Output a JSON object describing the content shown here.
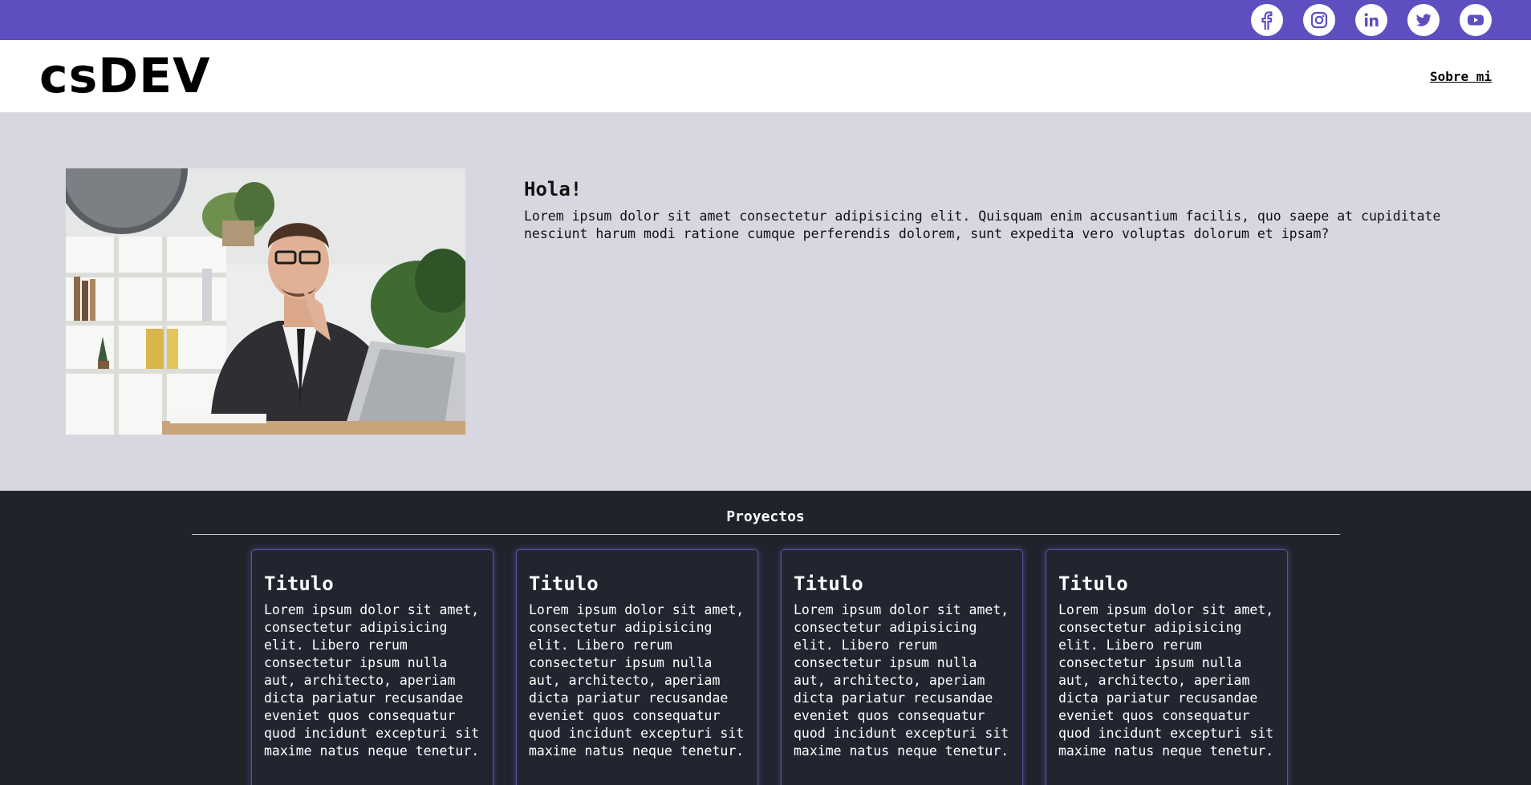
{
  "header": {
    "social_icons": [
      "facebook-icon",
      "instagram-icon",
      "linkedin-icon",
      "twitter-icon",
      "youtube-icon"
    ],
    "accent_color": "#5d4fc0"
  },
  "nav": {
    "logo": "csDEV",
    "link_label": "Sobre mi"
  },
  "hero": {
    "title": "Hola!",
    "body": "Lorem ipsum dolor sit amet consectetur adipisicing elit. Quisquam enim accusantium facilis, quo saepe at cupiditate nesciunt harum modi ratione cumque perferendis dolorem, sunt expedita vero voluptas dolorum et ipsam?",
    "background": "#d7d7e1"
  },
  "projects": {
    "title": "Proyectos",
    "background": "#20232b",
    "cards": [
      {
        "title": "Titulo",
        "body": "Lorem ipsum dolor sit amet, consectetur adipisicing elit. Libero rerum consectetur ipsum nulla aut, architecto, aperiam dicta pariatur recusandae eveniet quos consequatur quod incidunt excepturi sit maxime natus neque tenetur."
      },
      {
        "title": "Titulo",
        "body": "Lorem ipsum dolor sit amet, consectetur adipisicing elit. Libero rerum consectetur ipsum nulla aut, architecto, aperiam dicta pariatur recusandae eveniet quos consequatur quod incidunt excepturi sit maxime natus neque tenetur."
      },
      {
        "title": "Titulo",
        "body": "Lorem ipsum dolor sit amet, consectetur adipisicing elit. Libero rerum consectetur ipsum nulla aut, architecto, aperiam dicta pariatur recusandae eveniet quos consequatur quod incidunt excepturi sit maxime natus neque tenetur."
      },
      {
        "title": "Titulo",
        "body": "Lorem ipsum dolor sit amet, consectetur adipisicing elit. Libero rerum consectetur ipsum nulla aut, architecto, aperiam dicta pariatur recusandae eveniet quos consequatur quod incidunt excepturi sit maxime natus neque tenetur."
      }
    ]
  }
}
